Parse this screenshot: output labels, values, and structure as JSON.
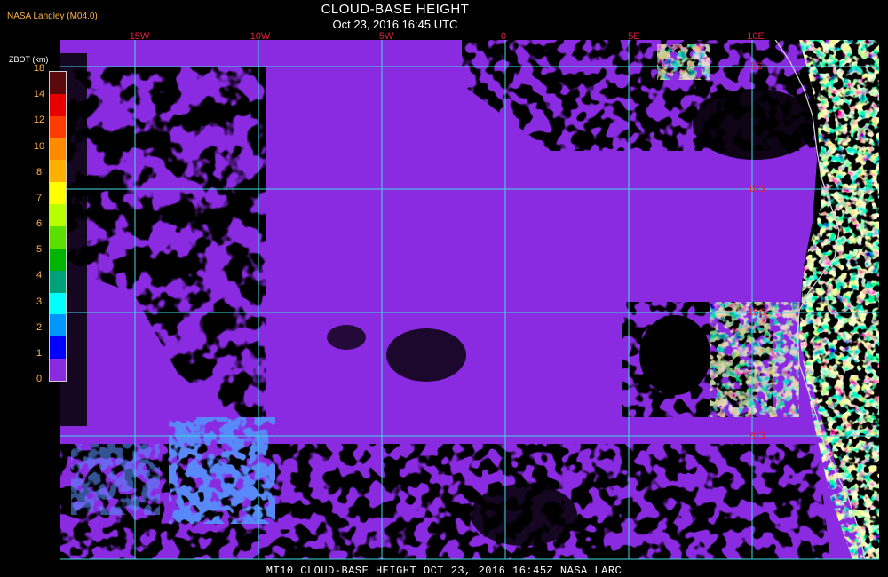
{
  "header": {
    "title": "CLOUD-BASE HEIGHT",
    "subtitle": "Oct 23, 2016 16:45 UTC",
    "producer": "NASA Langley (M04.0)"
  },
  "legend": {
    "label": "ZBOT (km)",
    "ticks": [
      "18",
      "14",
      "12",
      "10",
      "8",
      "7",
      "6",
      "5",
      "4",
      "3",
      "2",
      "1",
      "0"
    ],
    "colors": [
      "#5a0a0a",
      "#e80000",
      "#ff3c00",
      "#ff8c00",
      "#ffb000",
      "#ffff00",
      "#b8ff00",
      "#5ae000",
      "#00b400",
      "#00a078",
      "#00ffff",
      "#0096ff",
      "#0000ff",
      "#8a2be2"
    ]
  },
  "map": {
    "lon_labels": [
      "15W",
      "10W",
      "5W",
      "0",
      "5E",
      "10E"
    ],
    "lat_labels": [
      "5S",
      "10S",
      "15S",
      "20S"
    ],
    "grid_color": "#40d8e0",
    "land_color": "#000000",
    "cloud_low_color": "#8a2be2"
  },
  "footer": {
    "text": "MT10  CLOUD-BASE HEIGHT   OCT 23, 2016 16:45Z   NASA LARC"
  }
}
